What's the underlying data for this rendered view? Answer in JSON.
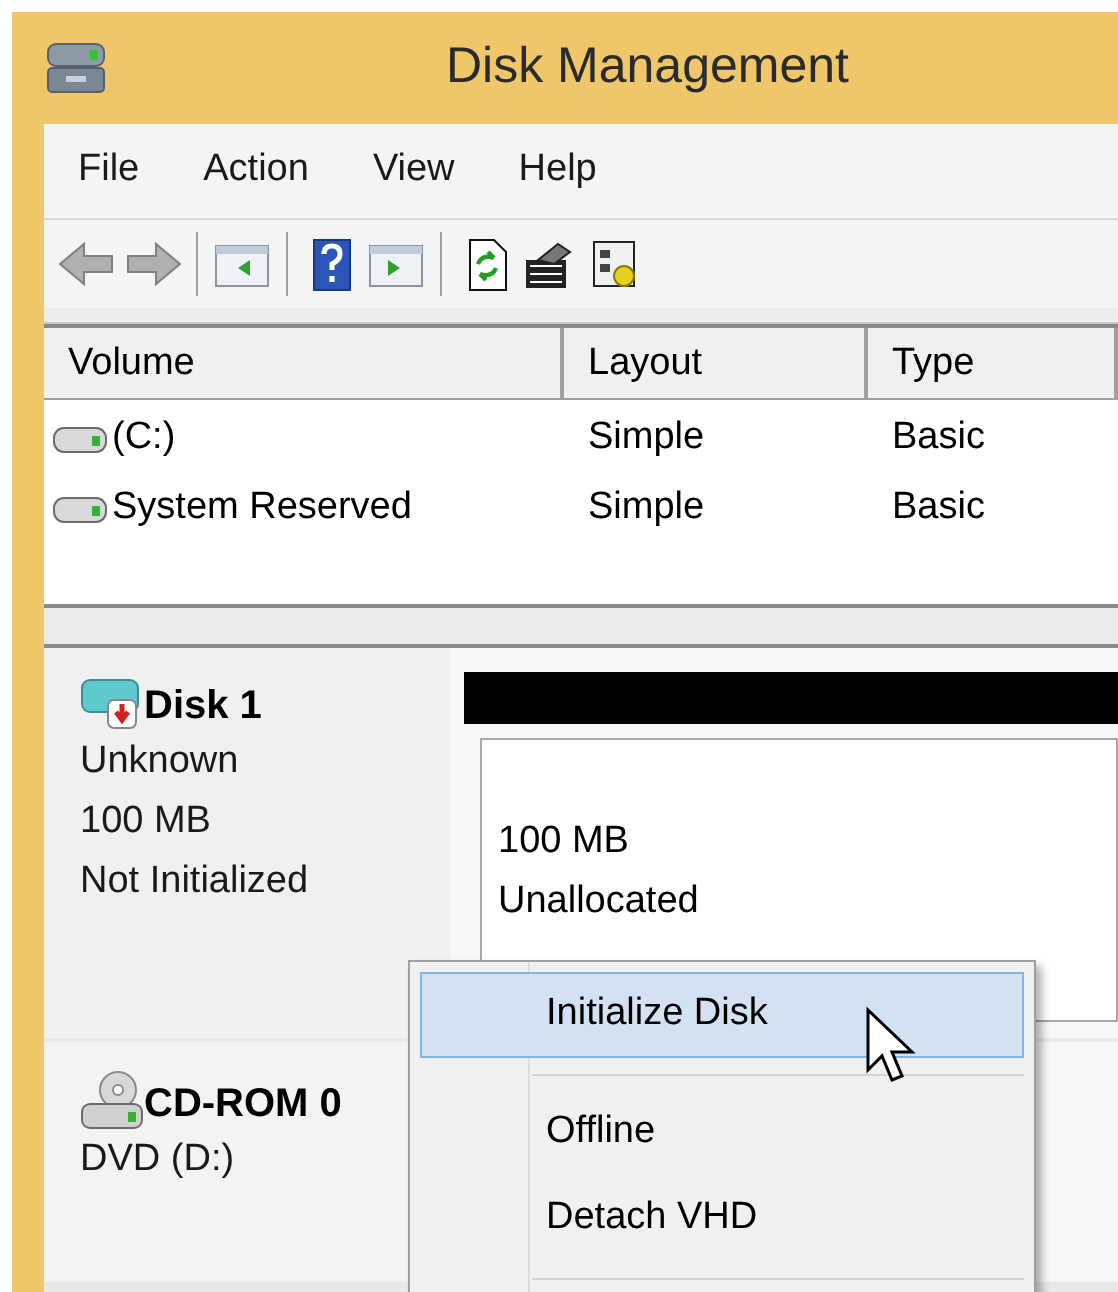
{
  "window": {
    "title": "Disk Management"
  },
  "menu": [
    "File",
    "Action",
    "View",
    "Help"
  ],
  "volumes_table": {
    "columns": [
      "Volume",
      "Layout",
      "Type"
    ],
    "rows": [
      {
        "volume": "(C:)",
        "layout": "Simple",
        "type": "Basic"
      },
      {
        "volume": "System Reserved",
        "layout": "Simple",
        "type": "Basic"
      }
    ]
  },
  "disks": [
    {
      "kind": "disk",
      "name": "Disk 1",
      "lines": [
        "Unknown",
        "100 MB",
        "Not Initialized"
      ],
      "partitions": [
        {
          "size": "100 MB",
          "status": "Unallocated"
        }
      ]
    },
    {
      "kind": "cdrom",
      "name": "CD-ROM 0",
      "lines": [
        "DVD (D:)"
      ]
    }
  ],
  "context_menu": {
    "items": [
      {
        "kind": "item",
        "label": "Initialize Disk",
        "selected": true
      },
      {
        "kind": "separator"
      },
      {
        "kind": "item",
        "label": "Offline",
        "selected": false
      },
      {
        "kind": "item",
        "label": "Detach VHD",
        "selected": false
      },
      {
        "kind": "separator"
      }
    ]
  }
}
